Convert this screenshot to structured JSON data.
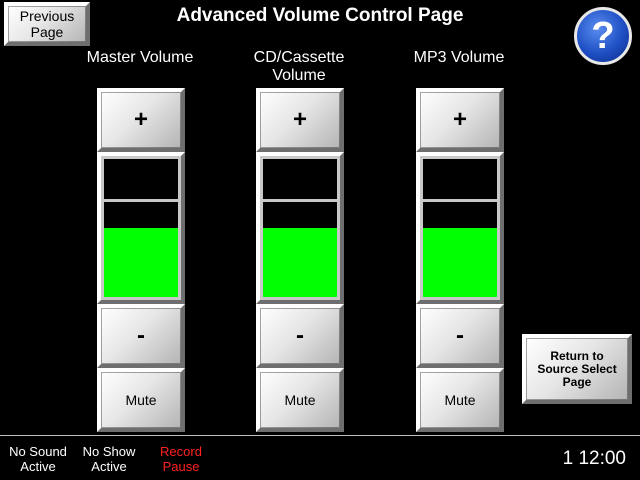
{
  "header": {
    "prev_label": "Previous Page",
    "title": "Advanced Volume Control Page",
    "help_icon": "question-mark-icon",
    "help_color": "#1f4fc4"
  },
  "channels": [
    {
      "label": "Master Volume",
      "plus": "+",
      "minus": "-",
      "mute": "Mute",
      "level": 0.5
    },
    {
      "label": "CD/Cassette Volume",
      "plus": "+",
      "minus": "-",
      "mute": "Mute",
      "level": 0.5
    },
    {
      "label": "MP3 Volume",
      "plus": "+",
      "minus": "-",
      "mute": "Mute",
      "level": 0.5
    }
  ],
  "return_label": "Return to Source Select Page",
  "status_bar": {
    "items": [
      {
        "text": "No Sound Active",
        "color": "#ffffff"
      },
      {
        "text": "No Show Active",
        "color": "#ffffff"
      },
      {
        "text": "Record Pause",
        "color": "#ff2020"
      }
    ],
    "clock": "1  12:00"
  },
  "colors": {
    "meter_fill": "#00ff00",
    "background": "#000000"
  }
}
